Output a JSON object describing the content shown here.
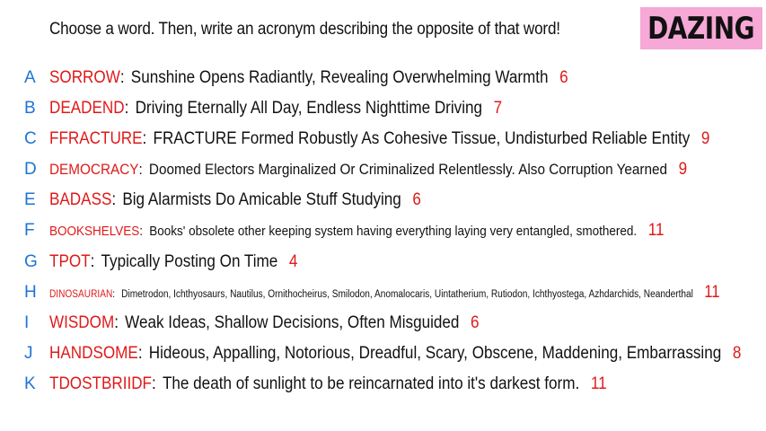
{
  "header": {
    "prompt": "Choose a word. Then, write an acronym describing the opposite of that word!",
    "logo_text": "DAZING",
    "logo_bg": "#f6a8d6"
  },
  "colors": {
    "letter": "#1e74d6",
    "word": "#e01919",
    "score": "#e01919",
    "text": "#111111"
  },
  "entries": [
    {
      "letter": "A",
      "word": "SORROW",
      "acronym": "Sunshine Opens Radiantly, Revealing Overwhelming Warmth",
      "score": "6"
    },
    {
      "letter": "B",
      "word": "DEADEND",
      "acronym": "Driving Eternally All Day, Endless Nighttime Driving",
      "score": "7"
    },
    {
      "letter": "C",
      "word": "FFRACTURE",
      "acronym": "FRACTURE  Formed Robustly As Cohesive Tissue, Undisturbed Reliable Entity",
      "score": "9"
    },
    {
      "letter": "D",
      "word": "DEMOCRACY",
      "acronym": "Doomed Electors Marginalized Or Criminalized Relentlessly. Also Corruption Yearned",
      "score": "9"
    },
    {
      "letter": "E",
      "word": "BADASS",
      "acronym": "Big Alarmists Do Amicable Stuff Studying",
      "score": "6"
    },
    {
      "letter": "F",
      "word": "BOOKSHELVES",
      "acronym": "Books' obsolete other keeping system having everything laying very entangled, smothered.",
      "score": "11"
    },
    {
      "letter": "G",
      "word": "TPOT",
      "acronym": "Typically Posting On Time",
      "score": "4"
    },
    {
      "letter": "H",
      "word": "DINOSAURIAN",
      "acronym": "Dimetrodon, Ichthyosaurs, Nautilus, Ornithocheirus, Smilodon, Anomalocaris, Uintatherium, Rutiodon, Ichthyostega, Azhdarchids, Neanderthal",
      "score": "11"
    },
    {
      "letter": "I",
      "word": "WISDOM",
      "acronym": "Weak Ideas, Shallow Decisions, Often Misguided",
      "score": "6"
    },
    {
      "letter": "J",
      "word": "HANDSOME",
      "acronym": "Hideous, Appalling, Notorious, Dreadful, Scary, Obscene, Maddening, Embarrassing",
      "score": "8"
    },
    {
      "letter": "K",
      "word": "TDOSTBRIIDF",
      "acronym": "The death of sunlight to be reincarnated into it's darkest form.",
      "score": "11"
    }
  ]
}
